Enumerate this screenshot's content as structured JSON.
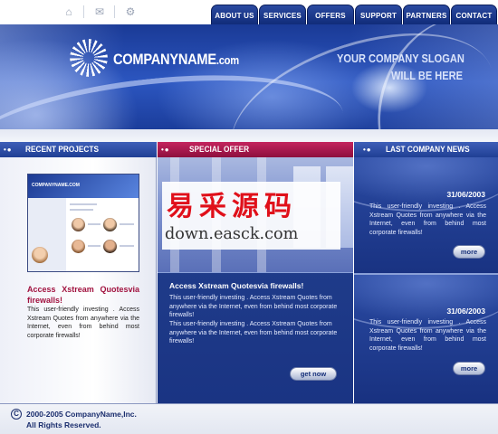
{
  "utility_icons": [
    "home-icon",
    "mail-icon",
    "sitemap-icon"
  ],
  "nav": {
    "tabs": [
      {
        "label": "ABOUT US"
      },
      {
        "label": "SERVICES"
      },
      {
        "label": "OFFERS"
      },
      {
        "label": "SUPPORT"
      },
      {
        "label": "PARTNERS"
      },
      {
        "label": "CONTACT US"
      }
    ]
  },
  "header": {
    "logo_name": "COMPANYNAME",
    "logo_domain": ".com",
    "slogan_line1": "YOUR COMPANY SLOGAN",
    "slogan_line2": "WILL BE HERE"
  },
  "sections": {
    "recent_projects": "RECENT PROJECTS",
    "special_offer": "SPECIAL OFFER",
    "company_news": "LAST COMPANY NEWS"
  },
  "recent_project": {
    "thumbnail_logo": "COMPANYNAME.COM",
    "title": "Access Xstream Quotesvia firewalls!",
    "body": "This user-friendly investing . Access Xstream Quotes from anywhere via the Internet, even from behind most corporate firewalls!"
  },
  "special_offer": {
    "watermark_cn": "易采源码",
    "watermark_url": "down.easck.com",
    "title": "Access Xstream Quotesvia firewalls!",
    "paragraph1": "This user-friendly investing . Access Xstream Quotes from anywhere via the Internet, even from behind most corporate firewalls!",
    "paragraph2": "This user-friendly investing . Access Xstream Quotes from anywhere via the Internet, even from behind most corporate firewalls!",
    "button": "get now"
  },
  "news": [
    {
      "date": "31/06/2003",
      "body": "This user-friendly investing . Access Xstream Quotes from anywhere via the Internet, even from behind most corporate firewalls!",
      "button": "more"
    },
    {
      "date": "31/06/2003",
      "body": "This user-friendly investing . Access Xstream Quotes from anywhere via the Internet, even from behind most corporate firewalls!",
      "button": "more"
    }
  ],
  "footer": {
    "copyright_symbol": "C",
    "line1": "2000-2005 CompanyName,Inc.",
    "line2": "All Rights Reserved."
  },
  "colors": {
    "primary_blue": "#1d3888",
    "accent_magenta": "#a1123f",
    "nav_tab": "#1a3584"
  }
}
